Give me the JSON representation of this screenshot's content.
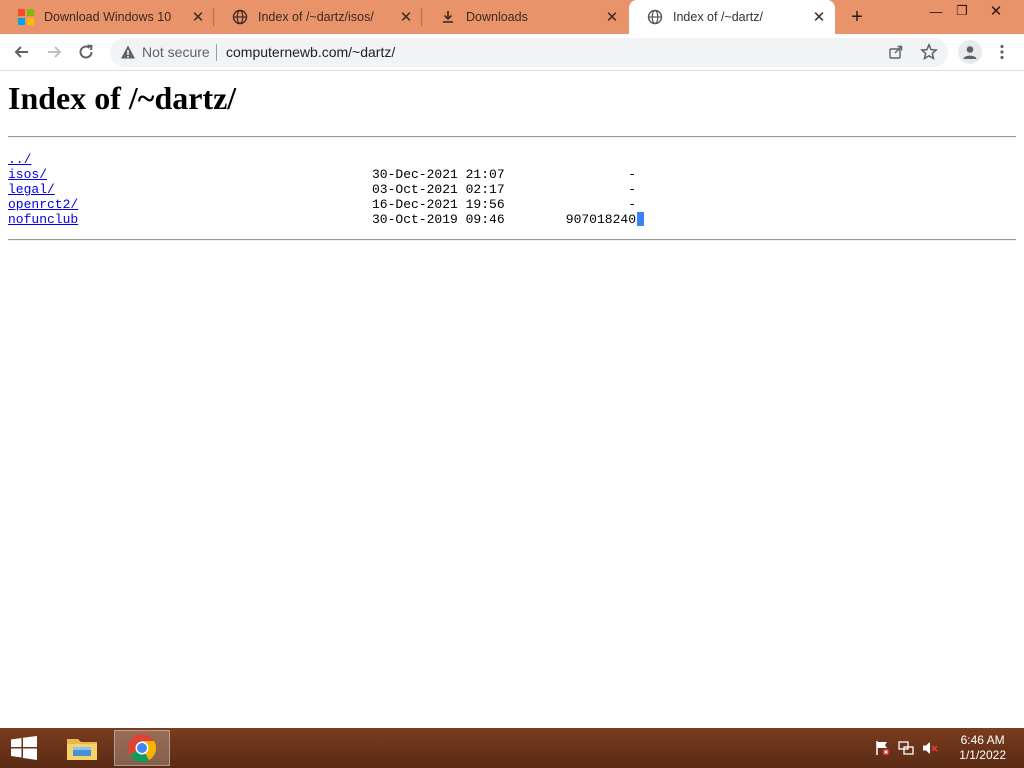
{
  "browser": {
    "tabs": [
      {
        "title": "Download Windows 10",
        "icon": "windows-logo-icon",
        "active": false
      },
      {
        "title": "Index of /~dartz/isos/",
        "icon": "globe-icon",
        "active": false
      },
      {
        "title": "Downloads",
        "icon": "download-icon",
        "active": false
      },
      {
        "title": "Index of /~dartz/",
        "icon": "globe-icon",
        "active": true
      }
    ],
    "new_tab_label": "+",
    "window_controls": {
      "minimize": "—",
      "restore": "❐",
      "close": "✕"
    },
    "security_label": "Not secure",
    "url": "computernewb.com/~dartz/"
  },
  "page": {
    "heading": "Index of /~dartz/",
    "parent_link": "../",
    "entries": [
      {
        "name": "isos/",
        "date": "30-Dec-2021 21:07",
        "size": "-"
      },
      {
        "name": "legal/",
        "date": "03-Oct-2021 02:17",
        "size": "-"
      },
      {
        "name": "openrct2/",
        "date": "16-Dec-2021 19:56",
        "size": "-"
      },
      {
        "name": "nofunclub",
        "date": "30-Oct-2019 09:46",
        "size": "907018240"
      }
    ]
  },
  "taskbar": {
    "apps": [
      "file-explorer-icon",
      "chrome-icon"
    ],
    "time": "6:46 AM",
    "date": "1/1/2022"
  },
  "colors": {
    "tabstrip": "#e9936a",
    "taskbar": "#6b331a",
    "link": "#0000ee",
    "cursor": "#3b82f6"
  }
}
